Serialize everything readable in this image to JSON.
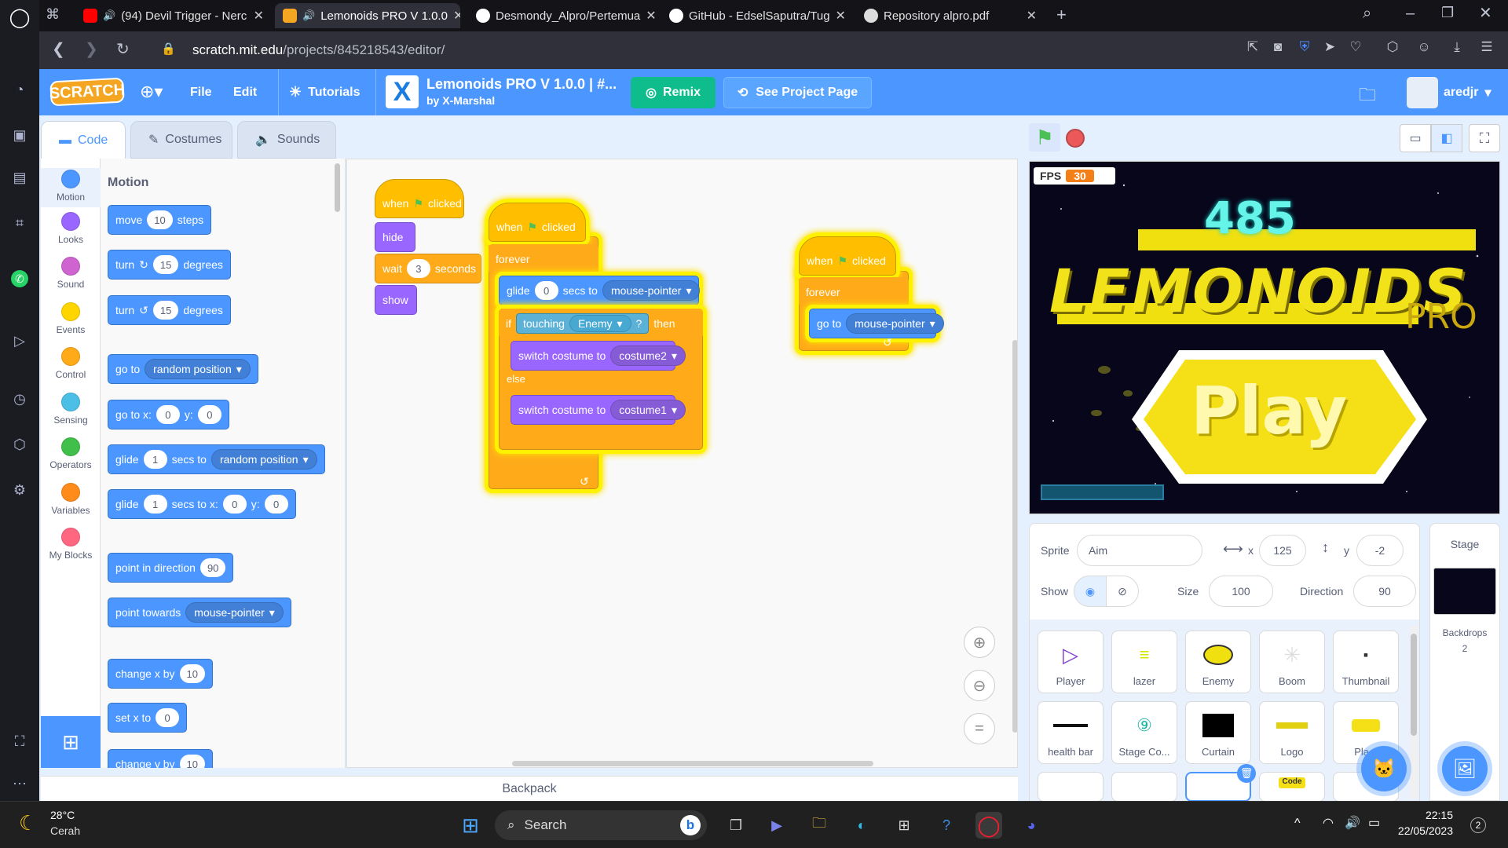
{
  "browser": {
    "tabs": [
      {
        "title": "(94) Devil Trigger - Nerc",
        "icon": "youtube-icon"
      },
      {
        "title": "Lemonoids PRO V 1.0.0",
        "icon": "scratch-icon",
        "active": true
      },
      {
        "title": "Desmondy_Alpro/Pertemua",
        "icon": "github-icon"
      },
      {
        "title": "GitHub - EdselSaputra/Tug",
        "icon": "github-icon"
      },
      {
        "title": "Repository alpro.pdf",
        "icon": "globe-icon"
      }
    ],
    "url_host": "scratch.mit.edu",
    "url_path": "/projects/845218543/editor/"
  },
  "menu": {
    "logo": "SCRATCH",
    "file": "File",
    "edit": "Edit",
    "tutorials": "Tutorials",
    "project_title": "Lemonoids PRO V 1.0.0 | #...",
    "author": "by X-Marshal",
    "remix": "Remix",
    "see_project": "See Project Page",
    "username": "aredjr"
  },
  "editor_tabs": {
    "code": "Code",
    "costumes": "Costumes",
    "sounds": "Sounds"
  },
  "categories": [
    {
      "label": "Motion",
      "color": "#4c97ff"
    },
    {
      "label": "Looks",
      "color": "#9966ff"
    },
    {
      "label": "Sound",
      "color": "#cf63cf"
    },
    {
      "label": "Events",
      "color": "#ffd500"
    },
    {
      "label": "Control",
      "color": "#ffab19"
    },
    {
      "label": "Sensing",
      "color": "#4cbfe6"
    },
    {
      "label": "Operators",
      "color": "#40bf4a"
    },
    {
      "label": "Variables",
      "color": "#ff8c1a"
    },
    {
      "label": "My Blocks",
      "color": "#ff6680"
    }
  ],
  "palette": {
    "heading": "Motion",
    "move": {
      "a": "move",
      "v": "10",
      "b": "steps"
    },
    "turn_cw": {
      "a": "turn",
      "v": "15",
      "b": "degrees"
    },
    "turn_ccw": {
      "a": "turn",
      "v": "15",
      "b": "degrees"
    },
    "goto": {
      "a": "go to",
      "dd": "random position"
    },
    "goto_xy": {
      "a": "go to x:",
      "x": "0",
      "b": "y:",
      "y": "0"
    },
    "glide": {
      "a": "glide",
      "v": "1",
      "b": "secs to",
      "dd": "random position"
    },
    "glide_xy": {
      "a": "glide",
      "v": "1",
      "b": "secs to x:",
      "x": "0",
      "c": "y:",
      "y": "0"
    },
    "point_dir": {
      "a": "point in direction",
      "v": "90"
    },
    "point_towards": {
      "a": "point towards",
      "dd": "mouse-pointer"
    },
    "change_x": {
      "a": "change x by",
      "v": "10"
    },
    "set_x": {
      "a": "set x to",
      "v": "0"
    },
    "change_y": {
      "a": "change y by",
      "v": "10"
    }
  },
  "script1": {
    "when": "when",
    "clicked": "clicked",
    "hide": "hide",
    "wait": "wait",
    "wait_v": "3",
    "seconds": "seconds",
    "show": "show"
  },
  "script2": {
    "when": "when",
    "clicked": "clicked",
    "forever": "forever",
    "glide": "glide",
    "glide_v": "0",
    "secs_to": "secs to",
    "glide_dd": "mouse-pointer",
    "if": "if",
    "touching": "touching",
    "touching_dd": "Enemy",
    "q": "?",
    "then": "then",
    "switch1": "switch costume to",
    "costume2": "costume2",
    "else": "else",
    "switch2": "switch costume to",
    "costume1": "costume1"
  },
  "script3": {
    "when": "when",
    "clicked": "clicked",
    "forever": "forever",
    "goto": "go to",
    "goto_dd": "mouse-pointer"
  },
  "backpack": "Backpack",
  "stage": {
    "fps_label": "FPS",
    "fps_value": "30",
    "score": "485",
    "title": "LEMONOIDS",
    "pro": "PRO",
    "play": "Play"
  },
  "sprite_info": {
    "sprite_label": "Sprite",
    "sprite_name": "Aim",
    "x_label": "x",
    "x": "125",
    "y_label": "y",
    "y": "-2",
    "show_label": "Show",
    "size_label": "Size",
    "size": "100",
    "direction_label": "Direction",
    "direction": "90"
  },
  "sprites": [
    "Player",
    "lazer",
    "Enemy",
    "Boom",
    "Thumbnail",
    "health bar",
    "Stage Co...",
    "Curtain",
    "Logo",
    "Pla..."
  ],
  "sprite_code_badge": "Code",
  "stage_panel": {
    "title": "Stage",
    "backdrops_label": "Backdrops",
    "backdrops_count": "2"
  },
  "taskbar": {
    "temp": "28°C",
    "weather": "Cerah",
    "search": "Search",
    "time": "22:15",
    "date": "22/05/2023",
    "notif_count": "2"
  }
}
